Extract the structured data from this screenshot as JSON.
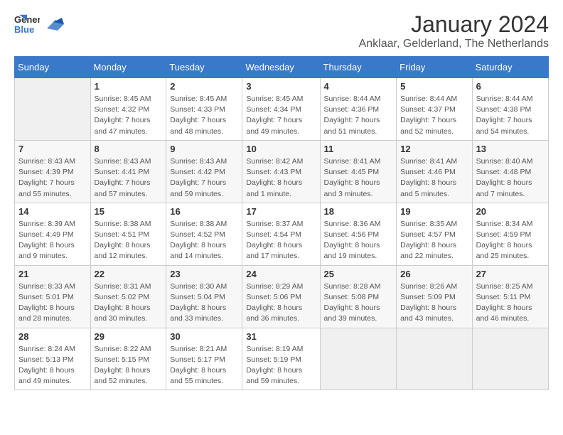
{
  "header": {
    "logo_general": "General",
    "logo_blue": "Blue",
    "title": "January 2024",
    "subtitle": "Anklaar, Gelderland, The Netherlands"
  },
  "weekdays": [
    "Sunday",
    "Monday",
    "Tuesday",
    "Wednesday",
    "Thursday",
    "Friday",
    "Saturday"
  ],
  "weeks": [
    [
      {
        "day": "",
        "empty": true
      },
      {
        "day": "1",
        "sunrise": "Sunrise: 8:45 AM",
        "sunset": "Sunset: 4:32 PM",
        "daylight": "Daylight: 7 hours and 47 minutes."
      },
      {
        "day": "2",
        "sunrise": "Sunrise: 8:45 AM",
        "sunset": "Sunset: 4:33 PM",
        "daylight": "Daylight: 7 hours and 48 minutes."
      },
      {
        "day": "3",
        "sunrise": "Sunrise: 8:45 AM",
        "sunset": "Sunset: 4:34 PM",
        "daylight": "Daylight: 7 hours and 49 minutes."
      },
      {
        "day": "4",
        "sunrise": "Sunrise: 8:44 AM",
        "sunset": "Sunset: 4:36 PM",
        "daylight": "Daylight: 7 hours and 51 minutes."
      },
      {
        "day": "5",
        "sunrise": "Sunrise: 8:44 AM",
        "sunset": "Sunset: 4:37 PM",
        "daylight": "Daylight: 7 hours and 52 minutes."
      },
      {
        "day": "6",
        "sunrise": "Sunrise: 8:44 AM",
        "sunset": "Sunset: 4:38 PM",
        "daylight": "Daylight: 7 hours and 54 minutes."
      }
    ],
    [
      {
        "day": "7",
        "sunrise": "Sunrise: 8:43 AM",
        "sunset": "Sunset: 4:39 PM",
        "daylight": "Daylight: 7 hours and 55 minutes."
      },
      {
        "day": "8",
        "sunrise": "Sunrise: 8:43 AM",
        "sunset": "Sunset: 4:41 PM",
        "daylight": "Daylight: 7 hours and 57 minutes."
      },
      {
        "day": "9",
        "sunrise": "Sunrise: 8:43 AM",
        "sunset": "Sunset: 4:42 PM",
        "daylight": "Daylight: 7 hours and 59 minutes."
      },
      {
        "day": "10",
        "sunrise": "Sunrise: 8:42 AM",
        "sunset": "Sunset: 4:43 PM",
        "daylight": "Daylight: 8 hours and 1 minute."
      },
      {
        "day": "11",
        "sunrise": "Sunrise: 8:41 AM",
        "sunset": "Sunset: 4:45 PM",
        "daylight": "Daylight: 8 hours and 3 minutes."
      },
      {
        "day": "12",
        "sunrise": "Sunrise: 8:41 AM",
        "sunset": "Sunset: 4:46 PM",
        "daylight": "Daylight: 8 hours and 5 minutes."
      },
      {
        "day": "13",
        "sunrise": "Sunrise: 8:40 AM",
        "sunset": "Sunset: 4:48 PM",
        "daylight": "Daylight: 8 hours and 7 minutes."
      }
    ],
    [
      {
        "day": "14",
        "sunrise": "Sunrise: 8:39 AM",
        "sunset": "Sunset: 4:49 PM",
        "daylight": "Daylight: 8 hours and 9 minutes."
      },
      {
        "day": "15",
        "sunrise": "Sunrise: 8:38 AM",
        "sunset": "Sunset: 4:51 PM",
        "daylight": "Daylight: 8 hours and 12 minutes."
      },
      {
        "day": "16",
        "sunrise": "Sunrise: 8:38 AM",
        "sunset": "Sunset: 4:52 PM",
        "daylight": "Daylight: 8 hours and 14 minutes."
      },
      {
        "day": "17",
        "sunrise": "Sunrise: 8:37 AM",
        "sunset": "Sunset: 4:54 PM",
        "daylight": "Daylight: 8 hours and 17 minutes."
      },
      {
        "day": "18",
        "sunrise": "Sunrise: 8:36 AM",
        "sunset": "Sunset: 4:56 PM",
        "daylight": "Daylight: 8 hours and 19 minutes."
      },
      {
        "day": "19",
        "sunrise": "Sunrise: 8:35 AM",
        "sunset": "Sunset: 4:57 PM",
        "daylight": "Daylight: 8 hours and 22 minutes."
      },
      {
        "day": "20",
        "sunrise": "Sunrise: 8:34 AM",
        "sunset": "Sunset: 4:59 PM",
        "daylight": "Daylight: 8 hours and 25 minutes."
      }
    ],
    [
      {
        "day": "21",
        "sunrise": "Sunrise: 8:33 AM",
        "sunset": "Sunset: 5:01 PM",
        "daylight": "Daylight: 8 hours and 28 minutes."
      },
      {
        "day": "22",
        "sunrise": "Sunrise: 8:31 AM",
        "sunset": "Sunset: 5:02 PM",
        "daylight": "Daylight: 8 hours and 30 minutes."
      },
      {
        "day": "23",
        "sunrise": "Sunrise: 8:30 AM",
        "sunset": "Sunset: 5:04 PM",
        "daylight": "Daylight: 8 hours and 33 minutes."
      },
      {
        "day": "24",
        "sunrise": "Sunrise: 8:29 AM",
        "sunset": "Sunset: 5:06 PM",
        "daylight": "Daylight: 8 hours and 36 minutes."
      },
      {
        "day": "25",
        "sunrise": "Sunrise: 8:28 AM",
        "sunset": "Sunset: 5:08 PM",
        "daylight": "Daylight: 8 hours and 39 minutes."
      },
      {
        "day": "26",
        "sunrise": "Sunrise: 8:26 AM",
        "sunset": "Sunset: 5:09 PM",
        "daylight": "Daylight: 8 hours and 43 minutes."
      },
      {
        "day": "27",
        "sunrise": "Sunrise: 8:25 AM",
        "sunset": "Sunset: 5:11 PM",
        "daylight": "Daylight: 8 hours and 46 minutes."
      }
    ],
    [
      {
        "day": "28",
        "sunrise": "Sunrise: 8:24 AM",
        "sunset": "Sunset: 5:13 PM",
        "daylight": "Daylight: 8 hours and 49 minutes."
      },
      {
        "day": "29",
        "sunrise": "Sunrise: 8:22 AM",
        "sunset": "Sunset: 5:15 PM",
        "daylight": "Daylight: 8 hours and 52 minutes."
      },
      {
        "day": "30",
        "sunrise": "Sunrise: 8:21 AM",
        "sunset": "Sunset: 5:17 PM",
        "daylight": "Daylight: 8 hours and 55 minutes."
      },
      {
        "day": "31",
        "sunrise": "Sunrise: 8:19 AM",
        "sunset": "Sunset: 5:19 PM",
        "daylight": "Daylight: 8 hours and 59 minutes."
      },
      {
        "day": "",
        "empty": true
      },
      {
        "day": "",
        "empty": true
      },
      {
        "day": "",
        "empty": true
      }
    ]
  ]
}
